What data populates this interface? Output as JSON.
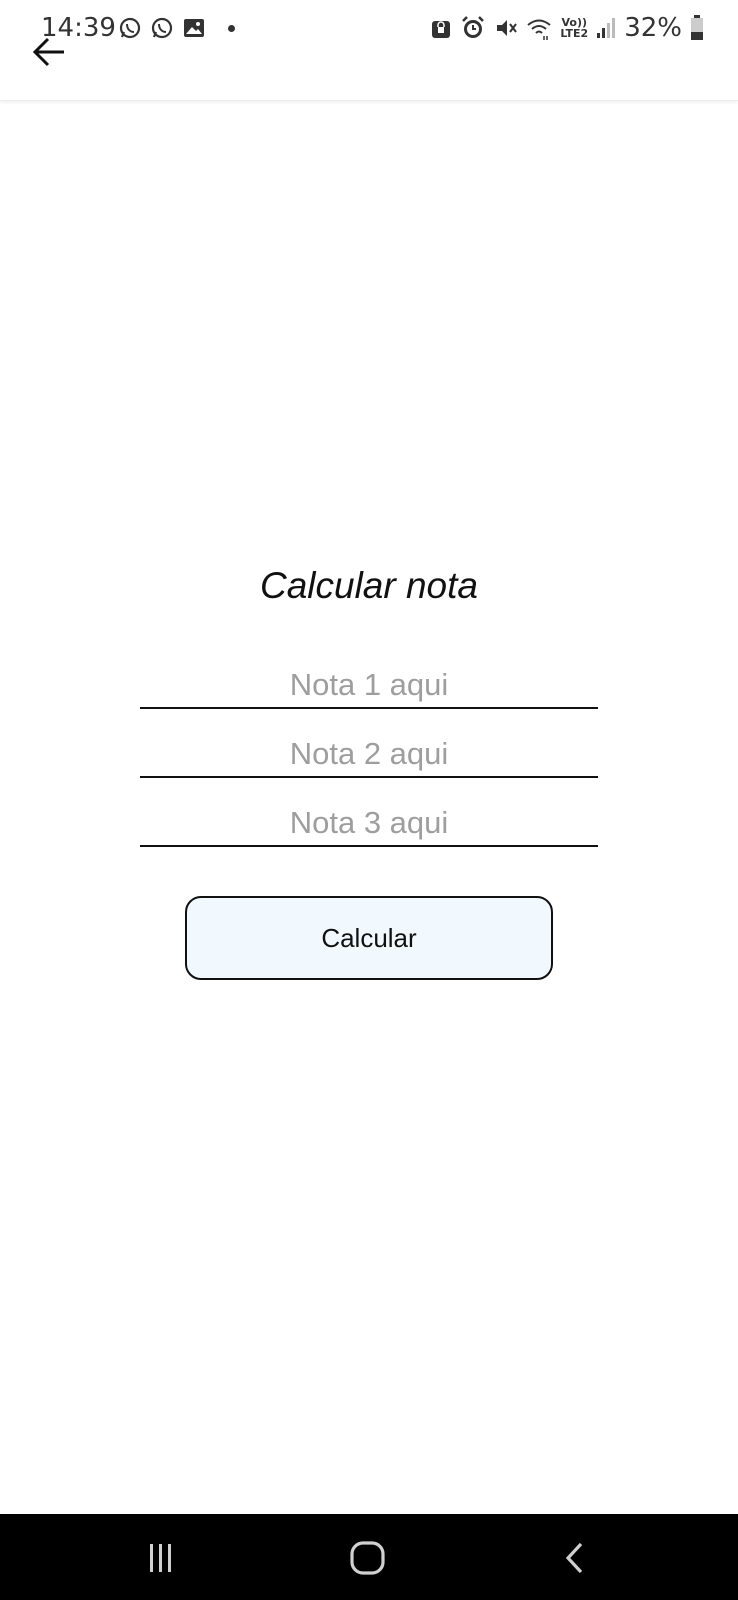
{
  "status_bar": {
    "time": "14:39",
    "left_icons": [
      "whatsapp-icon",
      "whatsapp-icon",
      "gallery-icon",
      "notification-dot"
    ],
    "right_icons": [
      "lock-icon",
      "alarm-icon",
      "mute-icon",
      "wifi-icon",
      "lte-icon",
      "signal-icon",
      "battery-icon"
    ],
    "lte_top": "Vo))",
    "lte_bottom": "LTE2",
    "battery": "32%"
  },
  "app_bar": {
    "back_icon": "arrow-left-icon"
  },
  "main": {
    "title": "Calcular nota",
    "fields": [
      {
        "placeholder": "Nota 1 aqui",
        "value": ""
      },
      {
        "placeholder": "Nota 2 aqui",
        "value": ""
      },
      {
        "placeholder": "Nota 3 aqui",
        "value": ""
      }
    ],
    "button_label": "Calcular",
    "button_bg": "#f1f9ff"
  },
  "nav_bar": {
    "icons": [
      "recents-icon",
      "home-icon",
      "back-icon"
    ]
  }
}
